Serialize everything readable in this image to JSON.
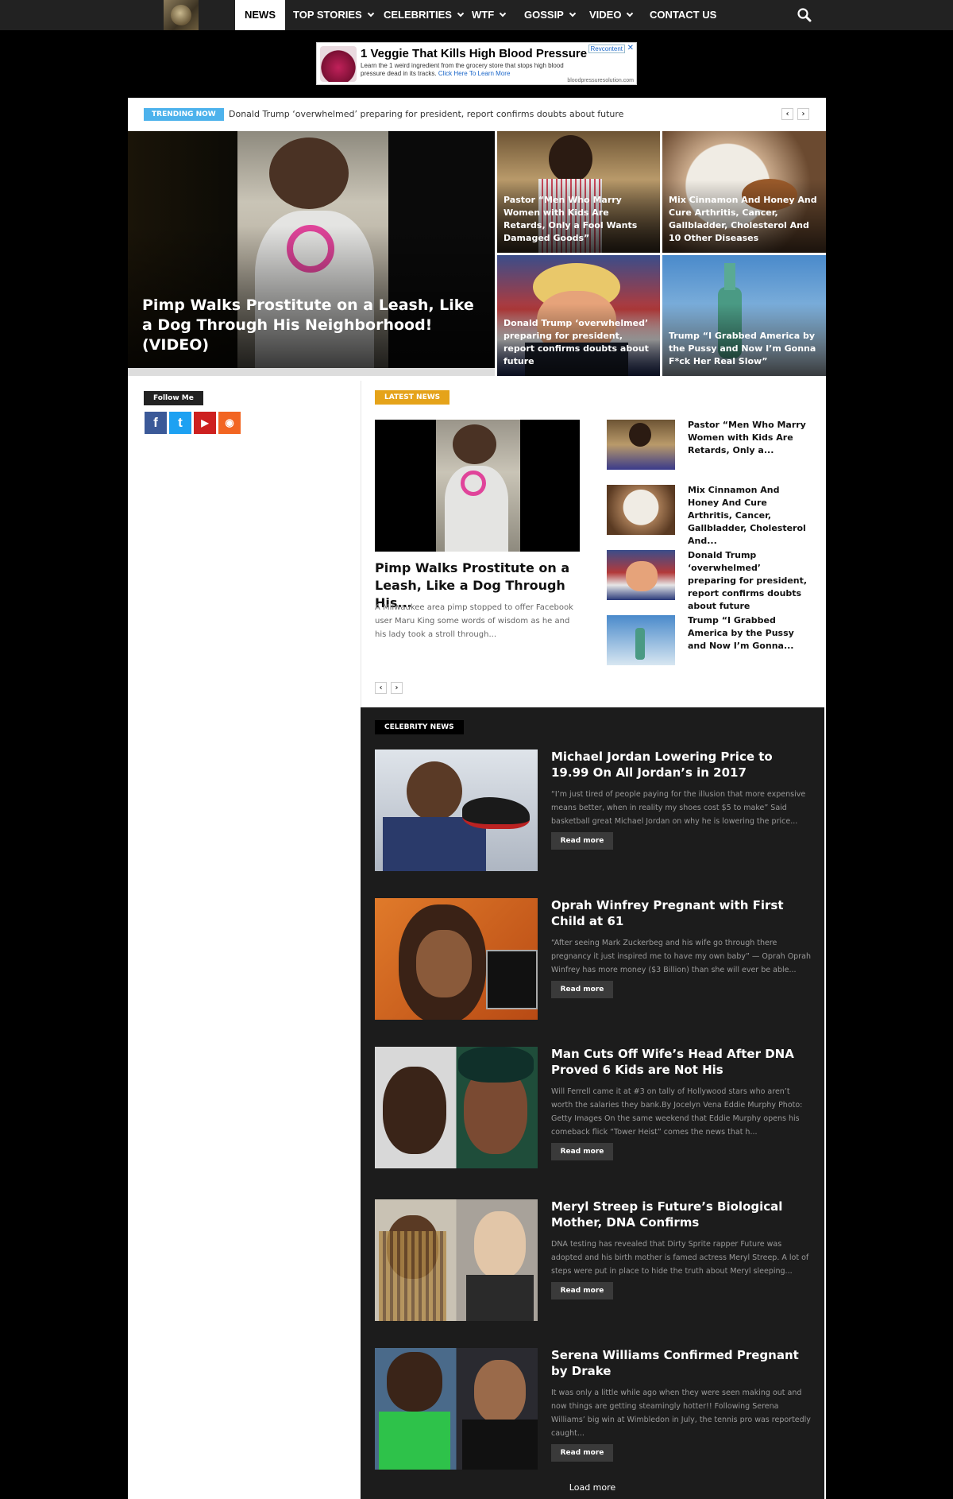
{
  "nav": {
    "items": [
      {
        "label": "NEWS",
        "active": true,
        "has_caret": false
      },
      {
        "label": "TOP STORIES",
        "active": false,
        "has_caret": true
      },
      {
        "label": "CELEBRITIES",
        "active": false,
        "has_caret": true
      },
      {
        "label": "WTF",
        "active": false,
        "has_caret": true
      },
      {
        "label": "GOSSIP",
        "active": false,
        "has_caret": true
      },
      {
        "label": "VIDEO",
        "active": false,
        "has_caret": true
      },
      {
        "label": "CONTACT US",
        "active": false,
        "has_caret": false
      }
    ],
    "search_icon": "search-icon"
  },
  "ad": {
    "title": "1 Veggie That Kills High Blood Pressure",
    "desc": "Learn the 1 weird ingredient from the grocery store that stops high blood pressure dead in its tracks.",
    "link": "Click Here To Learn More",
    "domain": "bloodpressuresolution.com",
    "badge": "Revcontent"
  },
  "trending": {
    "label": "TRENDING NOW",
    "text": "Donald Trump ‘overwhelmed’ preparing for president, report confirms doubts about future"
  },
  "hero": {
    "main": "Pimp Walks Prostitute on a Leash, Like a Dog Through His Neighborhood! (VIDEO)",
    "tiles": [
      "Pastor “Men Who Marry Women with Kids Are Retards, Only a Fool Wants Damaged Goods”",
      "Mix Cinnamon And Honey And Cure Arthritis, Cancer, Gallbladder, Cholesterol And 10 Other Diseases",
      "Donald Trump ‘overwhelmed’ preparing for president, report confirms doubts about future",
      "Trump “I Grabbed America by the Pussy and Now I’m Gonna F*ck Her Real Slow”"
    ]
  },
  "sidebar": {
    "follow_label": "Follow Me",
    "social": [
      {
        "name": "facebook-icon",
        "glyph": "f",
        "color": "#3b5998"
      },
      {
        "name": "twitter-icon",
        "glyph": "t",
        "color": "#1da1f2"
      },
      {
        "name": "youtube-icon",
        "glyph": "▶",
        "color": "#cd201f"
      },
      {
        "name": "rss-icon",
        "glyph": "◉",
        "color": "#f26522"
      }
    ]
  },
  "latest": {
    "label": "LATEST NEWS",
    "main_title": "Pimp Walks Prostitute on a Leash, Like a Dog Through His...",
    "main_excerpt": "A Milwaukee area pimp stopped to offer Facebook user Maru King some words of wisdom as he and his lady took a stroll through...",
    "side": [
      "Pastor “Men Who Marry Women with Kids Are Retards, Only a...",
      "Mix Cinnamon And Honey And Cure Arthritis, Cancer, Gallbladder, Cholesterol And...",
      "Donald Trump ‘overwhelmed’ preparing for president, report confirms doubts about future",
      "Trump “I Grabbed America by the Pussy and Now I’m Gonna..."
    ]
  },
  "celeb": {
    "label": "CELEBRITY NEWS",
    "read_more": "Read more",
    "load_more": "Load more",
    "posts": [
      {
        "title": "Michael Jordan Lowering Price to 19.99 On All Jordan’s in 2017",
        "excerpt": "“I’m just tired of people paying for the illusion that more expensive means better, when in reality my shoes cost $5 to make” Said basketball great Michael Jordan on why he is lowering the price..."
      },
      {
        "title": "Oprah Winfrey Pregnant with First Child at 61",
        "excerpt": "“After seeing Mark Zuckerbeg and his wife go through there pregnancy it just inspired me to have my own baby” — Oprah Oprah Winfrey has more money ($3 Billion) than she will ever be able..."
      },
      {
        "title": "Man Cuts Off Wife’s Head After DNA Proved 6 Kids are Not His",
        "excerpt": "Will Ferrell came it at #3 on tally of Hollywood stars who aren’t worth the salaries they bank.By Jocelyn Vena Eddie Murphy Photo: Getty Images On the same weekend that Eddie Murphy opens his comeback flick “Tower Heist” comes the news that h..."
      },
      {
        "title": "Meryl Streep is Future’s Biological Mother, DNA Confirms",
        "excerpt": "DNA testing has revealed that Dirty Sprite rapper Future was adopted and his birth mother is famed actress Meryl Streep. A lot of steps were put in place to hide the truth about Meryl sleeping..."
      },
      {
        "title": "Serena Williams Confirmed Pregnant by Drake",
        "excerpt": "It was only a little while ago when they were seen making out and now things are getting steamingly hotter!! Following Serena Williams’ big win at Wimbledon in July, the tennis pro was reportedly caught..."
      }
    ]
  }
}
